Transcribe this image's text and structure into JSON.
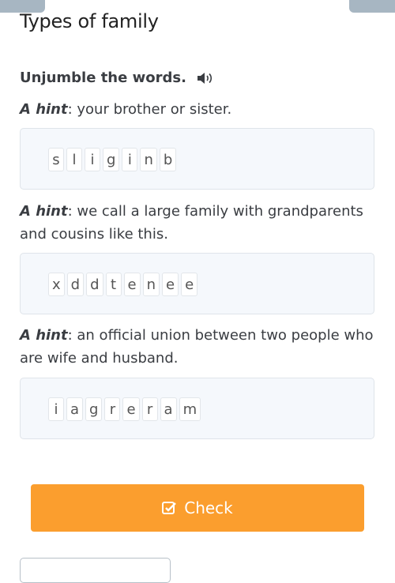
{
  "page": {
    "title": "Types of family"
  },
  "exercise": {
    "instruction": "Unjumble the words.",
    "audio_icon": "speaker-icon",
    "hint_label": "A hint",
    "items": [
      {
        "hint": ": your brother or sister.",
        "letters": [
          "s",
          "l",
          "i",
          "g",
          "i",
          "n",
          "b"
        ]
      },
      {
        "hint": ": we call a large family with grandparents and cousins like this.",
        "letters": [
          "x",
          "d",
          "d",
          "t",
          "e",
          "n",
          "e",
          "e"
        ]
      },
      {
        "hint": ": an official union between two people who are wife and husband.",
        "letters": [
          "i",
          "a",
          "g",
          "r",
          "e",
          "r",
          "a",
          "m"
        ]
      }
    ]
  },
  "actions": {
    "check_label": "Check",
    "check_icon": "checkbox-icon",
    "accent": "#fb9e2e"
  }
}
